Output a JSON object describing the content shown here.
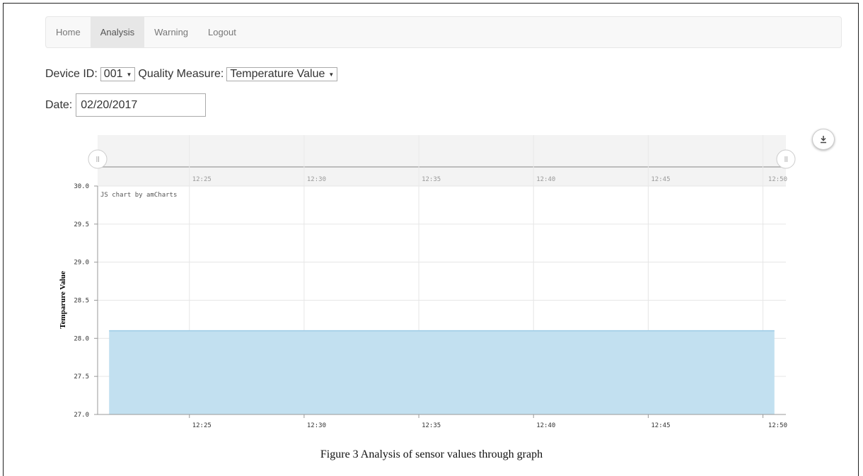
{
  "nav": {
    "items": [
      {
        "label": "Home"
      },
      {
        "label": "Analysis"
      },
      {
        "label": "Warning"
      },
      {
        "label": "Logout"
      }
    ]
  },
  "filters": {
    "device_label": "Device ID:",
    "device_value": "001",
    "measure_label": "Quality Measure:",
    "measure_value": "Temperature Value",
    "date_label": "Date:",
    "date_value": "02/20/2017"
  },
  "chart_data": {
    "type": "area",
    "ylabel": "Temparure Value",
    "credit": "JS chart by amCharts",
    "ylim": [
      27.0,
      30.0
    ],
    "yticks": [
      "30.0",
      "29.5",
      "29.0",
      "28.5",
      "28.0",
      "27.5",
      "27.0"
    ],
    "xlim": [
      "12:21",
      "12:51"
    ],
    "xticks": [
      "12:25",
      "12:30",
      "12:35",
      "12:40",
      "12:45",
      "12:50"
    ],
    "x": [
      "12:21:30",
      "12:50:30"
    ],
    "y": [
      28.1,
      28.1
    ],
    "grid": true,
    "scrollbar": true
  },
  "colors": {
    "area_fill": "#c2e0f0",
    "area_line": "#9ccbe6",
    "navbar_bg": "#f8f8f8"
  },
  "caption": "Figure 3  Analysis of sensor values through graph"
}
